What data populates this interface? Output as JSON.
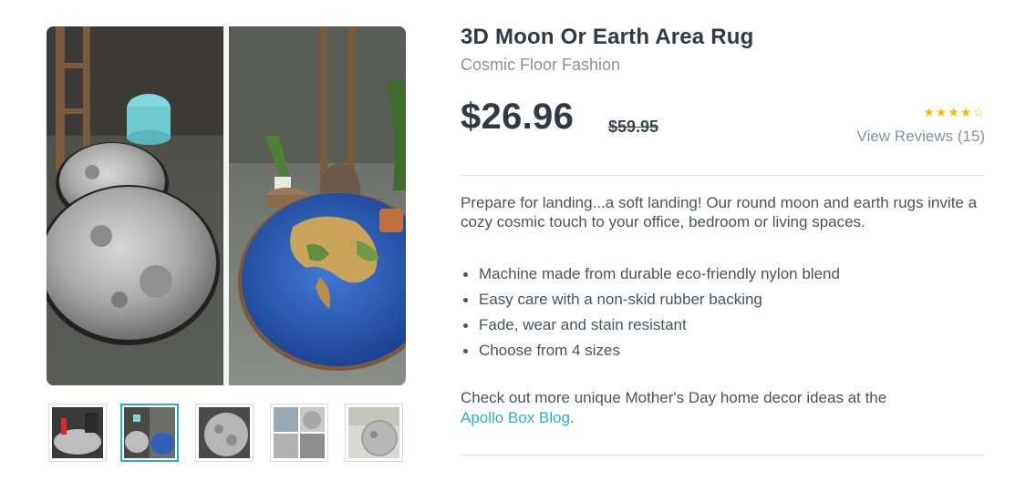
{
  "product": {
    "title": "3D Moon Or Earth Area Rug",
    "subtitle": "Cosmic Floor Fashion",
    "price": "$26.96",
    "old_price": "$59.95",
    "rating": 4,
    "rating_max": 5,
    "rating_stars": "★★★★",
    "rating_empty_star": "☆",
    "reviews_link": "View Reviews (15)"
  },
  "description": "Prepare for landing...a soft landing! Our round moon and earth rugs invite a cozy cosmic touch to your office, bedroom or living spaces.",
  "features": [
    "Machine made from durable eco-friendly nylon blend",
    "Easy care with a non-skid rubber backing",
    "Fade, wear and stain resistant",
    "Choose from 4 sizes"
  ],
  "blog_note": {
    "text": "Check out more unique Mother's Day home decor ideas at the",
    "link": "Apollo Box Blog",
    "suffix": "."
  },
  "gallery": {
    "active_index": 1,
    "thumbnails": [
      {
        "subject": "moon rug with fire hydrant decor"
      },
      {
        "subject": "moon and earth rugs side by side"
      },
      {
        "subject": "moon rug on floor"
      },
      {
        "subject": "rug collage grid"
      },
      {
        "subject": "moon rug in room"
      }
    ]
  },
  "colors": {
    "accent": "#2ab0c5",
    "star": "#f2c200",
    "text": "#2f3a46",
    "muted": "#8a939c"
  }
}
